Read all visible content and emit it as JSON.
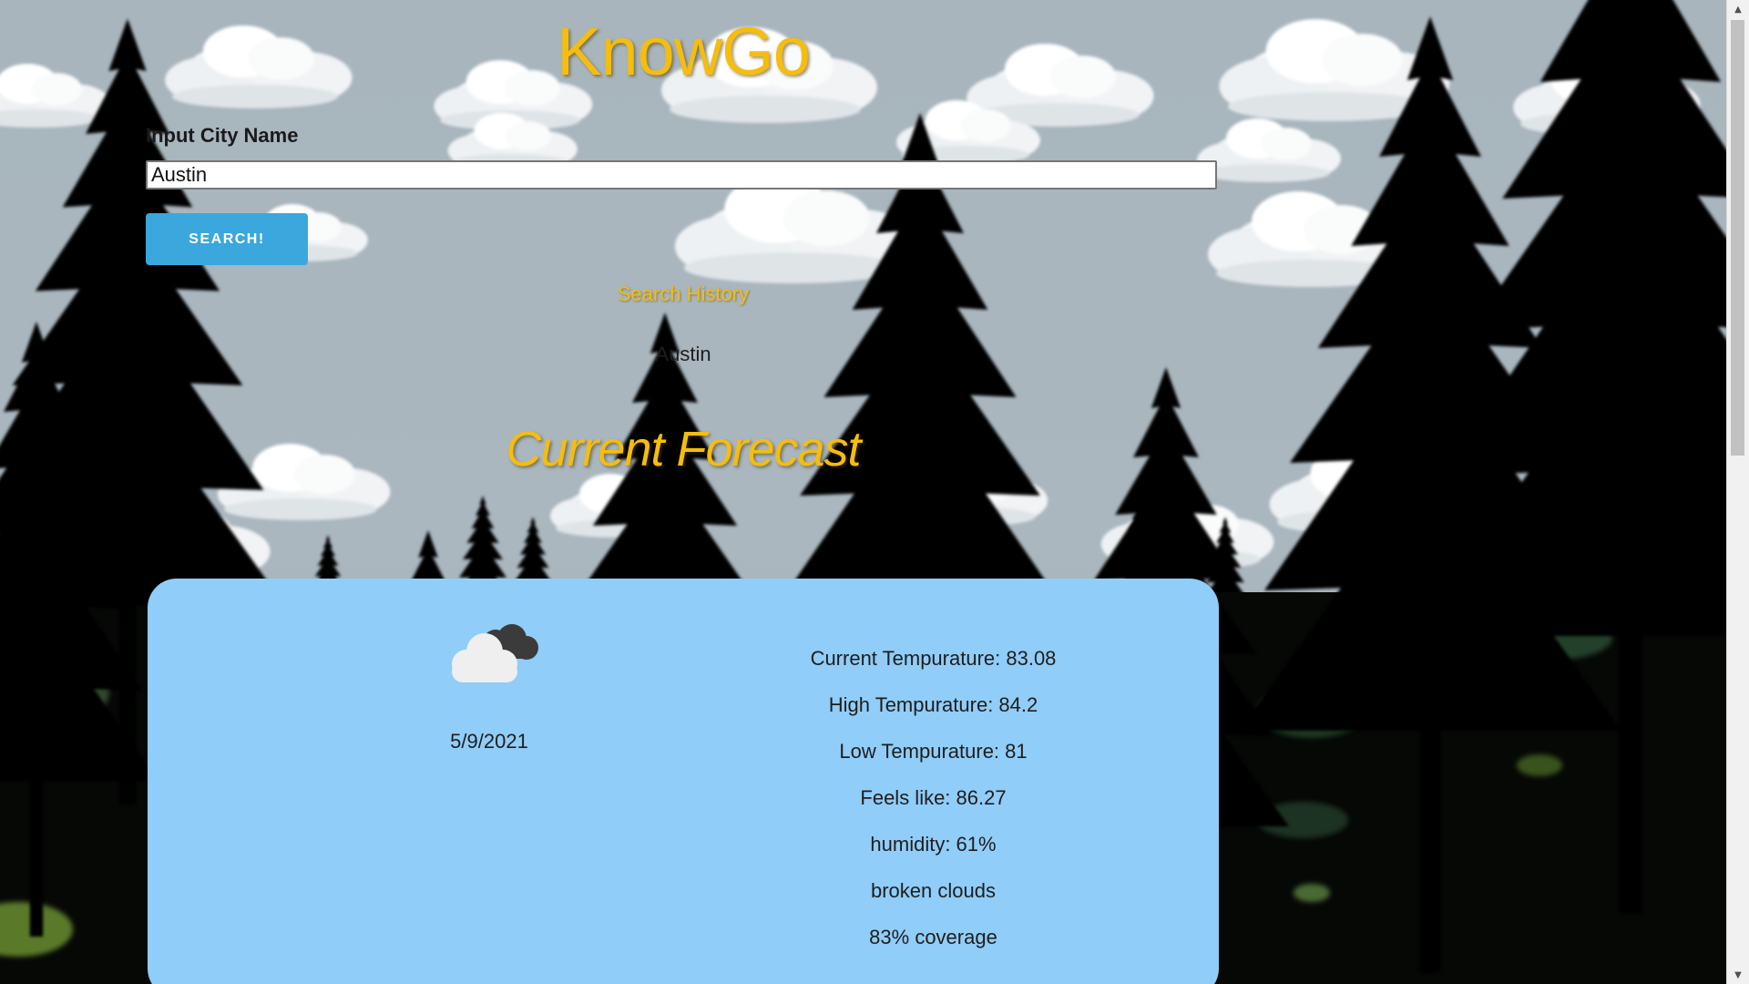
{
  "app": {
    "title": "KnowGo"
  },
  "search": {
    "label": "Input City Name",
    "value": "Austin",
    "button_label": "SEARCH!"
  },
  "history": {
    "title": "Search History",
    "items": [
      "Austin"
    ]
  },
  "forecast": {
    "heading": "Current Forecast",
    "icon": "broken-clouds-icon",
    "date": "5/9/2021",
    "stats": [
      "Current Tempurature: 83.08",
      "High Tempurature: 84.2",
      "Low Tempurature: 81",
      "Feels like: 86.27",
      "humidity: 61%",
      "broken clouds",
      "83% coverage"
    ]
  },
  "colors": {
    "accent_title": "#f4bd10",
    "button": "#3aa8dd",
    "card": "#90cdf8"
  }
}
